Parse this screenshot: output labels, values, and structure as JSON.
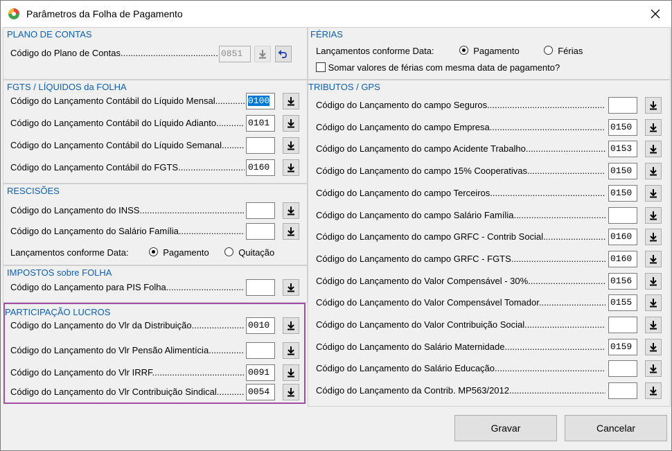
{
  "window": {
    "title": "Parâmetros da Folha de Pagamento"
  },
  "plano": {
    "title": "PLANO DE CONTAS",
    "label": "Código do Plano de Contas",
    "value": "0851"
  },
  "fgts": {
    "title": "FGTS / LÍQUIDOS da FOLHA",
    "rows": [
      {
        "label": "Código do Lançamento Contábil do Líquido Mensal",
        "value": "0100",
        "selected": true
      },
      {
        "label": "Código do Lançamento Contábil do Líquido Adianto",
        "value": "0101"
      },
      {
        "label": "Código do Lançamento Contábil do Líquido Semanal",
        "value": ""
      },
      {
        "label": "Código do Lançamento Contábil do FGTS",
        "value": "0160"
      }
    ]
  },
  "rescisoes": {
    "title": "RESCISÕES",
    "rows": [
      {
        "label": "Código do Lançamento do INSS",
        "value": ""
      },
      {
        "label": "Código do Lançamento do Salário Família",
        "value": ""
      }
    ],
    "radio_label": "Lançamentos conforme Data:",
    "radio_options": [
      "Pagamento",
      "Quitação"
    ],
    "radio_selected": "Pagamento"
  },
  "impostos": {
    "title": "IMPOSTOS sobre FOLHA",
    "rows": [
      {
        "label": "Código do Lançamento para PIS Folha",
        "value": ""
      }
    ]
  },
  "participacao": {
    "title": "PARTICIPAÇÃO  LUCROS",
    "rows": [
      {
        "label": "Código do Lançamento do Vlr da Distribuição",
        "value": "0010"
      },
      {
        "label": "Código do Lançamento do Vlr Pensão Alimentícia",
        "value": ""
      },
      {
        "label": "Código do Lançamento do Vlr IRRF",
        "value": "0091"
      },
      {
        "label": "Código do Lançamento do Vlr Contribuição Sindical",
        "value": "0054"
      }
    ]
  },
  "ferias": {
    "title": "FÉRIAS",
    "radio_label": "Lançamentos conforme Data:",
    "radio_options": [
      "Pagamento",
      "Férias"
    ],
    "radio_selected": "Pagamento",
    "checkbox_label": "Somar valores de férias com mesma data de pagamento?",
    "checked": false
  },
  "tributos": {
    "title": "TRIBUTOS /  GPS",
    "rows": [
      {
        "label": "Código do Lançamento do campo Seguros",
        "value": ""
      },
      {
        "label": "Código do Lançamento do campo Empresa",
        "value": "0150"
      },
      {
        "label": "Código do Lançamento do campo Acidente Trabalho",
        "value": "0153"
      },
      {
        "label": "Código do Lançamento do campo 15% Cooperativas",
        "value": "0150"
      },
      {
        "label": "Código do Lançamento do campo Terceiros",
        "value": "0150"
      },
      {
        "label": "Código do Lançamento do campo Salário Família",
        "value": ""
      },
      {
        "label": "Código do Lançamento do campo GRFC - Contrib Social",
        "value": "0160"
      },
      {
        "label": "Código do Lançamento do campo GRFC - FGTS",
        "value": "0160"
      },
      {
        "label": "Código do Lançamento do Valor Compensável - 30%",
        "value": "0156"
      },
      {
        "label": "Código do Lançamento do Valor Compensável Tomador",
        "value": "0155"
      },
      {
        "label": "Código do Lançamento do Valor Contribuição Social",
        "value": ""
      },
      {
        "label": "Código do Lançamento do Salário Maternidade",
        "value": "0159"
      },
      {
        "label": "Código do Lançamento do Salário Educação",
        "value": ""
      },
      {
        "label": "Código do Lançamento da Contrib. MP563/2012",
        "value": ""
      }
    ]
  },
  "buttons": {
    "save": "Gravar",
    "cancel": "Cancelar"
  },
  "colors": {
    "group_title": "#0b5fb4",
    "highlight": "#a04ea5",
    "selection": "#0078d7"
  }
}
